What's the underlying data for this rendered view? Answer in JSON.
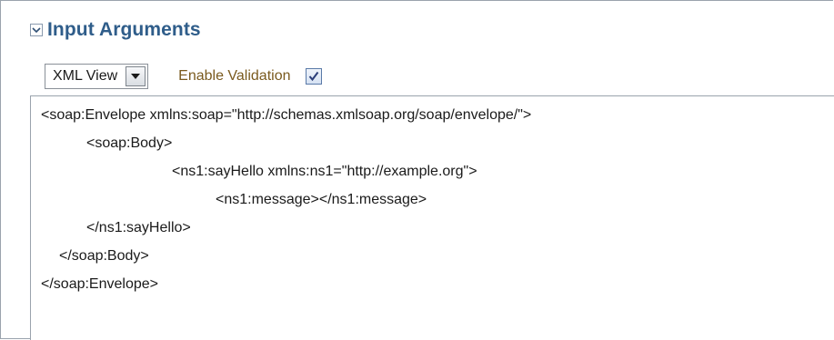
{
  "section": {
    "title": "Input Arguments",
    "toggle_icon": "chevron-down-icon"
  },
  "controls": {
    "view_select": {
      "value": "XML View",
      "icon": "dropdown-arrow-icon"
    },
    "validation_label": "Enable Validation",
    "validation_checked": true
  },
  "editor": {
    "lines": [
      "<soap:Envelope xmlns:soap=\"http://schemas.xmlsoap.org/soap/envelope/\">",
      "<soap:Body>",
      "<ns1:sayHello xmlns:ns1=\"http://example.org\">",
      "<ns1:message></ns1:message>",
      "</ns1:sayHello>",
      "</soap:Body>",
      "</soap:Envelope>"
    ]
  },
  "colors": {
    "title": "#2f5d8a",
    "label": "#7a5a1e",
    "border": "#9aa3ad"
  }
}
